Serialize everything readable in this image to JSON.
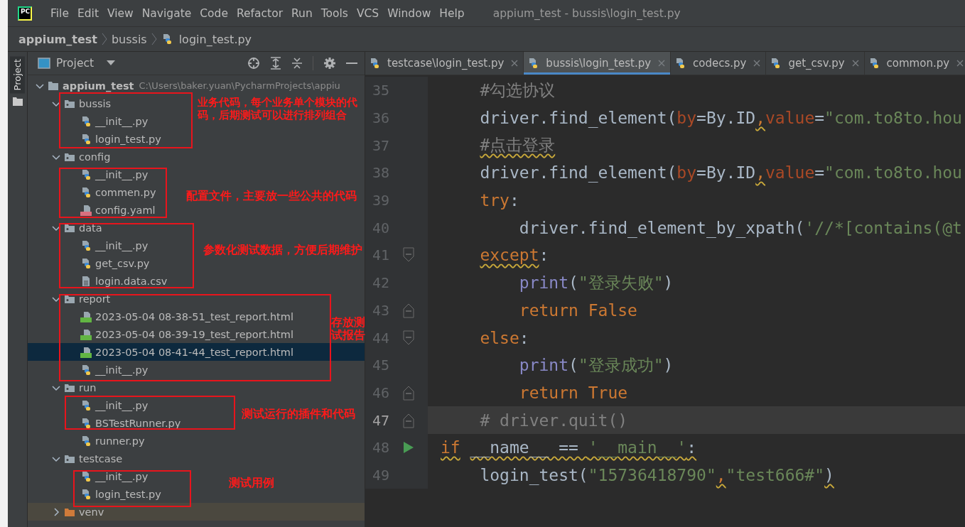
{
  "window": {
    "logo_text": "PC",
    "menu": [
      "File",
      "Edit",
      "View",
      "Navigate",
      "Code",
      "Refactor",
      "Run",
      "Tools",
      "VCS",
      "Window",
      "Help"
    ],
    "title": "appium_test - bussis\\login_test.py"
  },
  "breadcrumb": [
    {
      "label": "appium_test",
      "kind": "project"
    },
    {
      "label": "bussis",
      "kind": "folder"
    },
    {
      "label": "login_test.py",
      "kind": "python"
    }
  ],
  "tool_strip": {
    "label": "Project"
  },
  "project_panel": {
    "title": "Project",
    "tree": [
      {
        "name": "appium_test",
        "path": "C:\\Users\\baker.yuan\\PycharmProjects\\appiu",
        "kind": "root",
        "expanded": true,
        "selected": false,
        "children": [
          {
            "name": "bussis",
            "kind": "package",
            "expanded": true,
            "selected": false,
            "children": [
              {
                "name": "__init__.py",
                "kind": "python",
                "selected": false
              },
              {
                "name": "login_test.py",
                "kind": "python",
                "selected": false
              }
            ]
          },
          {
            "name": "config",
            "kind": "package",
            "expanded": true,
            "selected": false,
            "children": [
              {
                "name": "__init__.py",
                "kind": "python",
                "selected": false
              },
              {
                "name": "commen.py",
                "kind": "python",
                "selected": false
              },
              {
                "name": "config.yaml",
                "kind": "yaml",
                "selected": false
              }
            ]
          },
          {
            "name": "data",
            "kind": "package",
            "expanded": true,
            "selected": false,
            "children": [
              {
                "name": "__init__.py",
                "kind": "python",
                "selected": false
              },
              {
                "name": "get_csv.py",
                "kind": "python",
                "selected": false
              },
              {
                "name": "login.data.csv",
                "kind": "text",
                "selected": false
              }
            ]
          },
          {
            "name": "report",
            "kind": "package",
            "expanded": true,
            "selected": false,
            "children": [
              {
                "name": "2023-05-04 08-38-51_test_report.html",
                "kind": "html",
                "selected": false
              },
              {
                "name": "2023-05-04 08-39-19_test_report.html",
                "kind": "html",
                "selected": false
              },
              {
                "name": "2023-05-04 08-41-44_test_report.html",
                "kind": "html",
                "selected": true
              },
              {
                "name": "__init__.py",
                "kind": "python",
                "selected": false
              }
            ]
          },
          {
            "name": "run",
            "kind": "package",
            "expanded": true,
            "selected": false,
            "children": [
              {
                "name": "__init__.py",
                "kind": "python",
                "selected": false
              },
              {
                "name": "BSTestRunner.py",
                "kind": "python",
                "selected": false
              },
              {
                "name": "runner.py",
                "kind": "python",
                "selected": false
              }
            ]
          },
          {
            "name": "testcase",
            "kind": "package",
            "expanded": true,
            "selected": false,
            "children": [
              {
                "name": "__init__.py",
                "kind": "python",
                "selected": false
              },
              {
                "name": "login_test.py",
                "kind": "python",
                "selected": false
              }
            ]
          },
          {
            "name": "venv",
            "kind": "excluded",
            "expanded": false,
            "selected": false
          }
        ]
      }
    ]
  },
  "editor": {
    "tabs": [
      {
        "label": "testcase\\login_test.py",
        "selected": false
      },
      {
        "label": "bussis\\login_test.py",
        "selected": true
      },
      {
        "label": "codecs.py",
        "selected": false
      },
      {
        "label": "get_csv.py",
        "selected": false
      },
      {
        "label": "common.py",
        "selected": false
      }
    ],
    "lines": [
      {
        "number": "35",
        "kind": "plain",
        "current": false,
        "tokens": [
          {
            "text": "    #勾选协议",
            "kind": "comment",
            "wavy": false
          }
        ]
      },
      {
        "number": "36",
        "kind": "plain",
        "current": false,
        "tokens": [
          {
            "text": "    driver.find_element(",
            "kind": "plain",
            "wavy": false
          },
          {
            "text": "by",
            "kind": "param",
            "wavy": false
          },
          {
            "text": "=By.ID",
            "kind": "plain",
            "wavy": false
          },
          {
            "text": ",",
            "kind": "keyword",
            "wavy": true
          },
          {
            "text": "value",
            "kind": "param",
            "wavy": false
          },
          {
            "text": "=",
            "kind": "plain",
            "wavy": false
          },
          {
            "text": "\"com.to8to.hou",
            "kind": "string",
            "wavy": false
          }
        ]
      },
      {
        "number": "37",
        "kind": "plain",
        "current": false,
        "tokens": [
          {
            "text": "    #点击登录",
            "kind": "comment",
            "wavy": true
          }
        ]
      },
      {
        "number": "38",
        "kind": "plain",
        "current": false,
        "tokens": [
          {
            "text": "    driver.find_element(",
            "kind": "plain",
            "wavy": false
          },
          {
            "text": "by",
            "kind": "param",
            "wavy": false
          },
          {
            "text": "=By.ID",
            "kind": "plain",
            "wavy": false
          },
          {
            "text": ",",
            "kind": "keyword",
            "wavy": true
          },
          {
            "text": "value",
            "kind": "param",
            "wavy": false
          },
          {
            "text": "=",
            "kind": "plain",
            "wavy": false
          },
          {
            "text": "\"com.to8to.hou",
            "kind": "string",
            "wavy": false
          }
        ]
      },
      {
        "number": "39",
        "kind": "plain",
        "current": false,
        "tokens": [
          {
            "text": "    try",
            "kind": "keyword",
            "wavy": false
          },
          {
            "text": ":",
            "kind": "plain",
            "wavy": false
          }
        ]
      },
      {
        "number": "40",
        "kind": "plain",
        "current": false,
        "tokens": [
          {
            "text": "        driver.find_element_by_xpath(",
            "kind": "plain",
            "wavy": false
          },
          {
            "text": "'//*[contains(@t",
            "kind": "string",
            "wavy": false
          }
        ]
      },
      {
        "number": "41",
        "kind": "fold_start",
        "current": false,
        "tokens": [
          {
            "text": "    except",
            "kind": "keyword",
            "wavy": true
          },
          {
            "text": ":",
            "kind": "plain",
            "wavy": false
          }
        ]
      },
      {
        "number": "42",
        "kind": "plain",
        "current": false,
        "tokens": [
          {
            "text": "        print",
            "kind": "builtin",
            "wavy": false
          },
          {
            "text": "(",
            "kind": "plain",
            "wavy": false
          },
          {
            "text": "\"登录失败\"",
            "kind": "string",
            "wavy": false
          },
          {
            "text": ")",
            "kind": "plain",
            "wavy": false
          }
        ]
      },
      {
        "number": "43",
        "kind": "fold_end",
        "current": false,
        "tokens": [
          {
            "text": "        return False",
            "kind": "keyword",
            "wavy": false
          }
        ]
      },
      {
        "number": "44",
        "kind": "fold_start",
        "current": false,
        "tokens": [
          {
            "text": "    else",
            "kind": "keyword",
            "wavy": false
          },
          {
            "text": ":",
            "kind": "plain",
            "wavy": false
          }
        ]
      },
      {
        "number": "45",
        "kind": "plain",
        "current": false,
        "tokens": [
          {
            "text": "        print",
            "kind": "builtin",
            "wavy": false
          },
          {
            "text": "(",
            "kind": "plain",
            "wavy": false
          },
          {
            "text": "\"登录成功\"",
            "kind": "string",
            "wavy": false
          },
          {
            "text": ")",
            "kind": "plain",
            "wavy": false
          }
        ]
      },
      {
        "number": "46",
        "kind": "fold_end",
        "current": false,
        "tokens": [
          {
            "text": "        return True",
            "kind": "keyword",
            "wavy": false
          }
        ]
      },
      {
        "number": "47",
        "kind": "fold_end",
        "current": true,
        "tokens": [
          {
            "text": "    # driver.quit()",
            "kind": "comment",
            "wavy": false
          }
        ]
      },
      {
        "number": "48",
        "kind": "run",
        "current": false,
        "tokens": [
          {
            "text": "if",
            "kind": "keyword",
            "wavy": true
          },
          {
            "text": " __name__ == ",
            "kind": "plain",
            "wavy": true
          },
          {
            "text": "'__main__'",
            "kind": "string",
            "wavy": true
          },
          {
            "text": ":",
            "kind": "plain",
            "wavy": true
          }
        ]
      },
      {
        "number": "49",
        "kind": "plain",
        "current": false,
        "tokens": [
          {
            "text": "    login_test(",
            "kind": "plain",
            "wavy": false
          },
          {
            "text": "\"15736418790\"",
            "kind": "string",
            "wavy": false
          },
          {
            "text": ",",
            "kind": "keyword",
            "wavy": true
          },
          {
            "text": "\"test666#\"",
            "kind": "string",
            "wavy": false
          },
          {
            "text": ")",
            "kind": "plain",
            "wavy": true
          }
        ]
      }
    ]
  },
  "annotations": [
    {
      "text": "业务代码，每个业务单个模块的代码，后期测试可以进行排列组合"
    },
    {
      "text": "配置文件，主要放一些公共的代码"
    },
    {
      "text": "参数化测试数据，方便后期维护"
    },
    {
      "text": "存放测试报告"
    },
    {
      "text": "测试运行的插件和代码"
    },
    {
      "text": "测试用例"
    }
  ]
}
